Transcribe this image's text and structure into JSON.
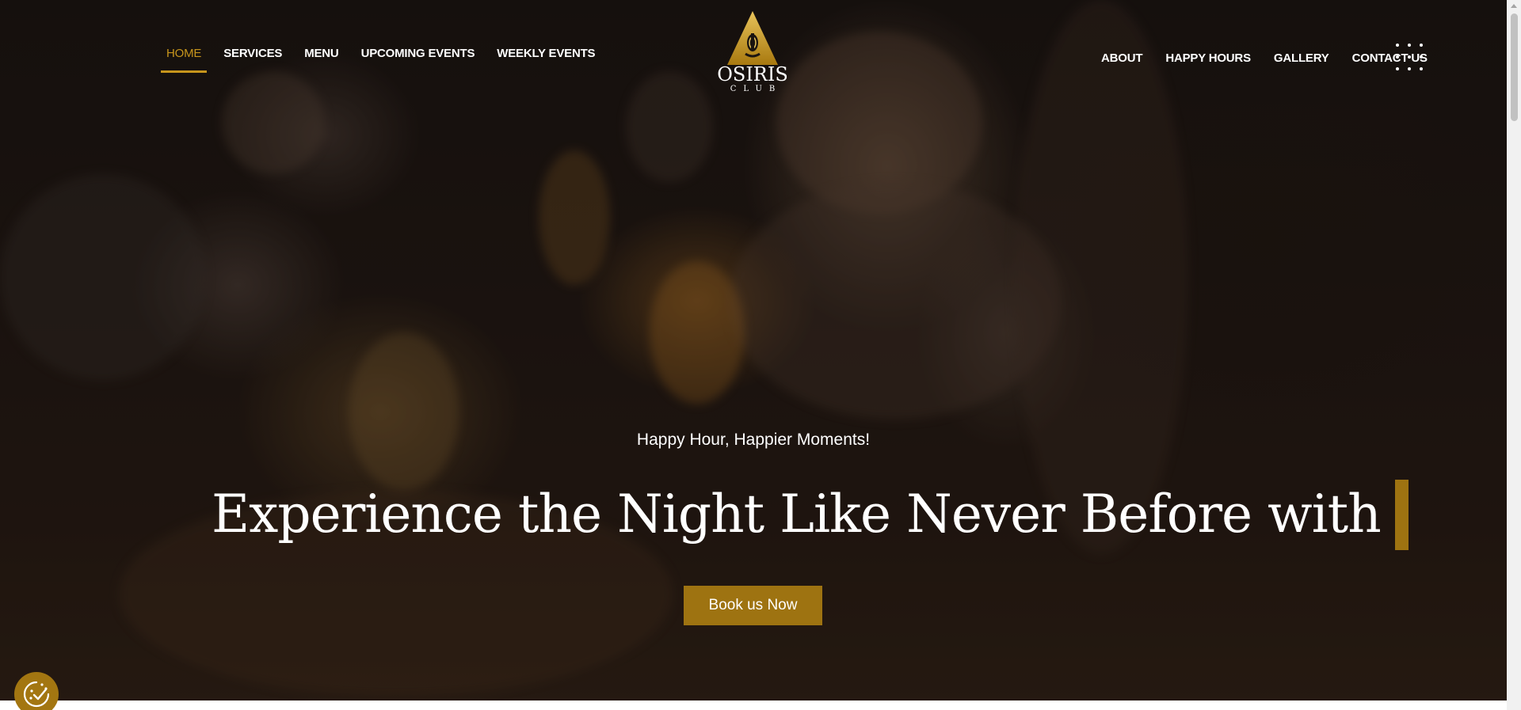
{
  "nav": {
    "left_items": [
      {
        "label": "HOME"
      },
      {
        "label": "SERVICES"
      },
      {
        "label": "MENU"
      },
      {
        "label": "UPCOMING EVENTS"
      },
      {
        "label": "WEEKLY EVENTS"
      }
    ],
    "right_items": [
      {
        "label": "ABOUT"
      },
      {
        "label": "HAPPY HOURS"
      },
      {
        "label": "GALLERY"
      },
      {
        "label": "CONTACT US"
      }
    ],
    "active": "HOME",
    "menu_icon": "grid-dots-icon"
  },
  "logo": {
    "word": "OSIRIS",
    "sub": "CLUB",
    "icon": "pyramid-icon"
  },
  "hero": {
    "tagline": "Happy Hour, Happier Moments!",
    "headline": "Experience the Night Like Never Before with",
    "cta_label": "Book us Now"
  },
  "consent": {
    "icon": "cookie-consent-icon"
  },
  "colors": {
    "accent": "#c7951c",
    "button": "#9e7311",
    "text": "#ffffff"
  }
}
